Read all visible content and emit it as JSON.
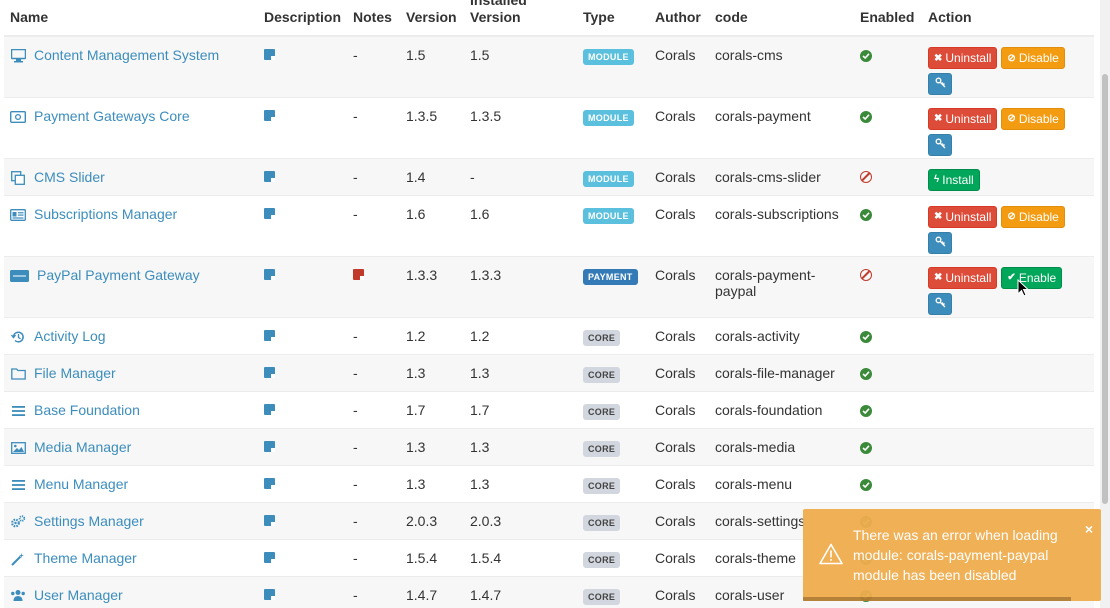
{
  "columns": {
    "name": "Name",
    "description": "Description",
    "notes": "Notes",
    "version": "Version",
    "installed_version_top": "Installed",
    "installed_version": "Version",
    "type": "Type",
    "author": "Author",
    "code": "code",
    "enabled": "Enabled",
    "action": "Action"
  },
  "buttons": {
    "uninstall": "Uninstall",
    "disable": "Disable",
    "enable": "Enable",
    "install": "Install"
  },
  "rows": [
    {
      "name": "Content Management System",
      "icon": "desktop-icon",
      "notes": "-",
      "version": "1.5",
      "installed": "1.5",
      "type": "MODULE",
      "author": "Corals",
      "code": "corals-cms",
      "enabled": true
    },
    {
      "name": "Payment Gateways Core",
      "icon": "money-icon",
      "notes": "-",
      "version": "1.3.5",
      "installed": "1.3.5",
      "type": "MODULE",
      "author": "Corals",
      "code": "corals-payment",
      "enabled": true
    },
    {
      "name": "CMS Slider",
      "icon": "clone-icon",
      "notes": "-",
      "version": "1.4",
      "installed": "-",
      "type": "MODULE",
      "author": "Corals",
      "code": "corals-cms-slider",
      "enabled": false
    },
    {
      "name": "Subscriptions Manager",
      "icon": "id-card-icon",
      "notes": "-",
      "version": "1.6",
      "installed": "1.6",
      "type": "MODULE",
      "author": "Corals",
      "code": "corals-subscriptions",
      "enabled": true
    },
    {
      "name": "PayPal Payment Gateway",
      "icon": "paypal-icon",
      "notes": "",
      "version": "1.3.3",
      "installed": "1.3.3",
      "type": "PAYMENT",
      "author": "Corals",
      "code_line1": "corals-payment-",
      "code_line2": "paypal",
      "enabled": false
    },
    {
      "name": "Activity Log",
      "icon": "history-icon",
      "notes": "-",
      "version": "1.2",
      "installed": "1.2",
      "type": "CORE",
      "author": "Corals",
      "code": "corals-activity",
      "enabled": true
    },
    {
      "name": "File Manager",
      "icon": "folder-icon",
      "notes": "-",
      "version": "1.3",
      "installed": "1.3",
      "type": "CORE",
      "author": "Corals",
      "code": "corals-file-manager",
      "enabled": true
    },
    {
      "name": "Base Foundation",
      "icon": "bars-icon",
      "notes": "-",
      "version": "1.7",
      "installed": "1.7",
      "type": "CORE",
      "author": "Corals",
      "code": "corals-foundation",
      "enabled": true
    },
    {
      "name": "Media Manager",
      "icon": "image-icon",
      "notes": "-",
      "version": "1.3",
      "installed": "1.3",
      "type": "CORE",
      "author": "Corals",
      "code": "corals-media",
      "enabled": true
    },
    {
      "name": "Menu Manager",
      "icon": "bars-icon",
      "notes": "-",
      "version": "1.3",
      "installed": "1.3",
      "type": "CORE",
      "author": "Corals",
      "code": "corals-menu",
      "enabled": true
    },
    {
      "name": "Settings Manager",
      "icon": "cogs-icon",
      "notes": "-",
      "version": "2.0.3",
      "installed": "2.0.3",
      "type": "CORE",
      "author": "Corals",
      "code": "corals-settings",
      "enabled": true
    },
    {
      "name": "Theme Manager",
      "icon": "magic-icon",
      "notes": "-",
      "version": "1.5.4",
      "installed": "1.5.4",
      "type": "CORE",
      "author": "Corals",
      "code": "corals-theme",
      "enabled": true
    },
    {
      "name": "User Manager",
      "icon": "users-icon",
      "notes": "-",
      "version": "1.4.7",
      "installed": "1.4.7",
      "type": "CORE",
      "author": "Corals",
      "code": "corals-user",
      "enabled": true
    }
  ],
  "toast": {
    "message": "There was an error when loading module: corals-payment-paypal module has been disabled",
    "close": "×"
  },
  "colors": {
    "link": "#3c8dbc",
    "danger": "#dd4b39",
    "warning": "#f39c12",
    "success": "#00a65a",
    "toast": "#f0ad4e"
  }
}
